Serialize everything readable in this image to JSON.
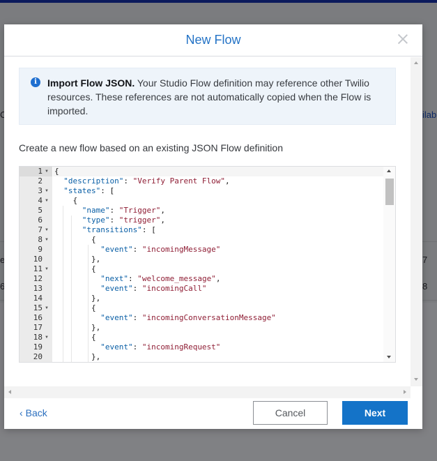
{
  "background": {
    "fragments": [
      "C",
      "ilab",
      "el",
      "7",
      "6",
      "8"
    ]
  },
  "modal": {
    "title": "New Flow",
    "close_icon": "close-icon",
    "info": {
      "icon": "info-icon",
      "title": "Import Flow JSON.",
      "body": " Your Studio Flow definition may reference other Twilio resources. These references are not automatically copied when the Flow is imported."
    },
    "description": "Create a new flow based on an existing JSON Flow definition",
    "editor": {
      "line_numbers": [
        "1",
        "2",
        "3",
        "4",
        "5",
        "6",
        "7",
        "8",
        "9",
        "10",
        "11",
        "12",
        "13",
        "14",
        "15",
        "16",
        "17",
        "18",
        "19",
        "20"
      ],
      "fold_markers": [
        "1",
        "3",
        "4",
        "7",
        "8",
        "11",
        "15",
        "18"
      ],
      "lines": [
        "{",
        "  \"description\": \"Verify Parent Flow\",",
        "  \"states\": [",
        "    {",
        "      \"name\": \"Trigger\",",
        "      \"type\": \"trigger\",",
        "      \"transitions\": [",
        "        {",
        "          \"event\": \"incomingMessage\"",
        "        },",
        "        {",
        "          \"next\": \"welcome_message\",",
        "          \"event\": \"incomingCall\"",
        "        },",
        "        {",
        "          \"event\": \"incomingConversationMessage\"",
        "        },",
        "        {",
        "          \"event\": \"incomingRequest\"",
        "        },"
      ]
    },
    "footer": {
      "back_label": "Back",
      "cancel_label": "Cancel",
      "next_label": "Next"
    }
  },
  "colors": {
    "accent": "#1473c8",
    "title": "#2473c6",
    "info_bg": "#eef4fa",
    "json_key": "#0a5fa6",
    "json_string": "#8f1e35"
  }
}
